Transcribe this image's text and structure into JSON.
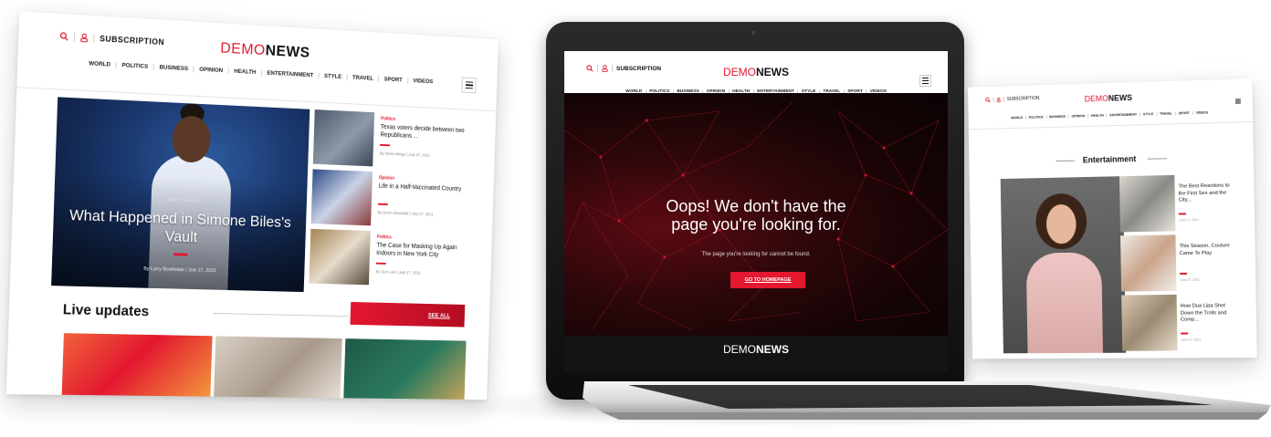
{
  "brand": {
    "part1": "DEMO",
    "part2": "NEWS"
  },
  "header": {
    "subscription": "SUBSCRIPTION"
  },
  "nav": [
    "WORLD",
    "POLITICS",
    "BUSINESS",
    "OPINION",
    "HEALTH",
    "ENTERTAINMENT",
    "STYLE",
    "TRAVEL",
    "SPORT",
    "VIDEOS"
  ],
  "left_site": {
    "hero": {
      "category": "Sports Travel",
      "title": "What Happened in Simone Biles's Vault",
      "byline": "By Larry Boothdale  |  July 27, 2021"
    },
    "side_stories": [
      {
        "category": "Politics",
        "title": "Texas voters decide between two Republicans ...",
        "byline": "By Steve Mingo  |  July 27, 2021"
      },
      {
        "category": "Opinion",
        "title": "Life in a Half-Vaccinated Country",
        "byline": "By Kevin Shonidak  |  July 27, 2021"
      },
      {
        "category": "Politics",
        "title": "The Case for Masking Up Again Indoors in New York City",
        "byline": "By Don Lalo  |  July 27, 2021"
      }
    ],
    "live_updates": {
      "heading": "Live updates",
      "see_all": "SEE ALL"
    }
  },
  "laptop_site": {
    "error_heading": "Oops! We don't have the page you're looking for.",
    "error_text": "The page you're looking for cannot be found.",
    "home_button": "GO TO HOMEPAGE"
  },
  "right_site": {
    "section_title": "Entertainment",
    "stories": [
      {
        "title": "The Best Reactions to the First Sex and the City...",
        "byline": "June 27, 2021"
      },
      {
        "title": "This Season, Couture Came To Play",
        "byline": "June 27, 2021"
      },
      {
        "title": "How Dua Lipa Shot Down the Trolls and Comp...",
        "byline": "June 27, 2021"
      }
    ]
  },
  "colors": {
    "accent": "#e3172f",
    "dark_bg": "#150405"
  },
  "icons": [
    "search-icon",
    "user-icon",
    "menu-icon"
  ]
}
